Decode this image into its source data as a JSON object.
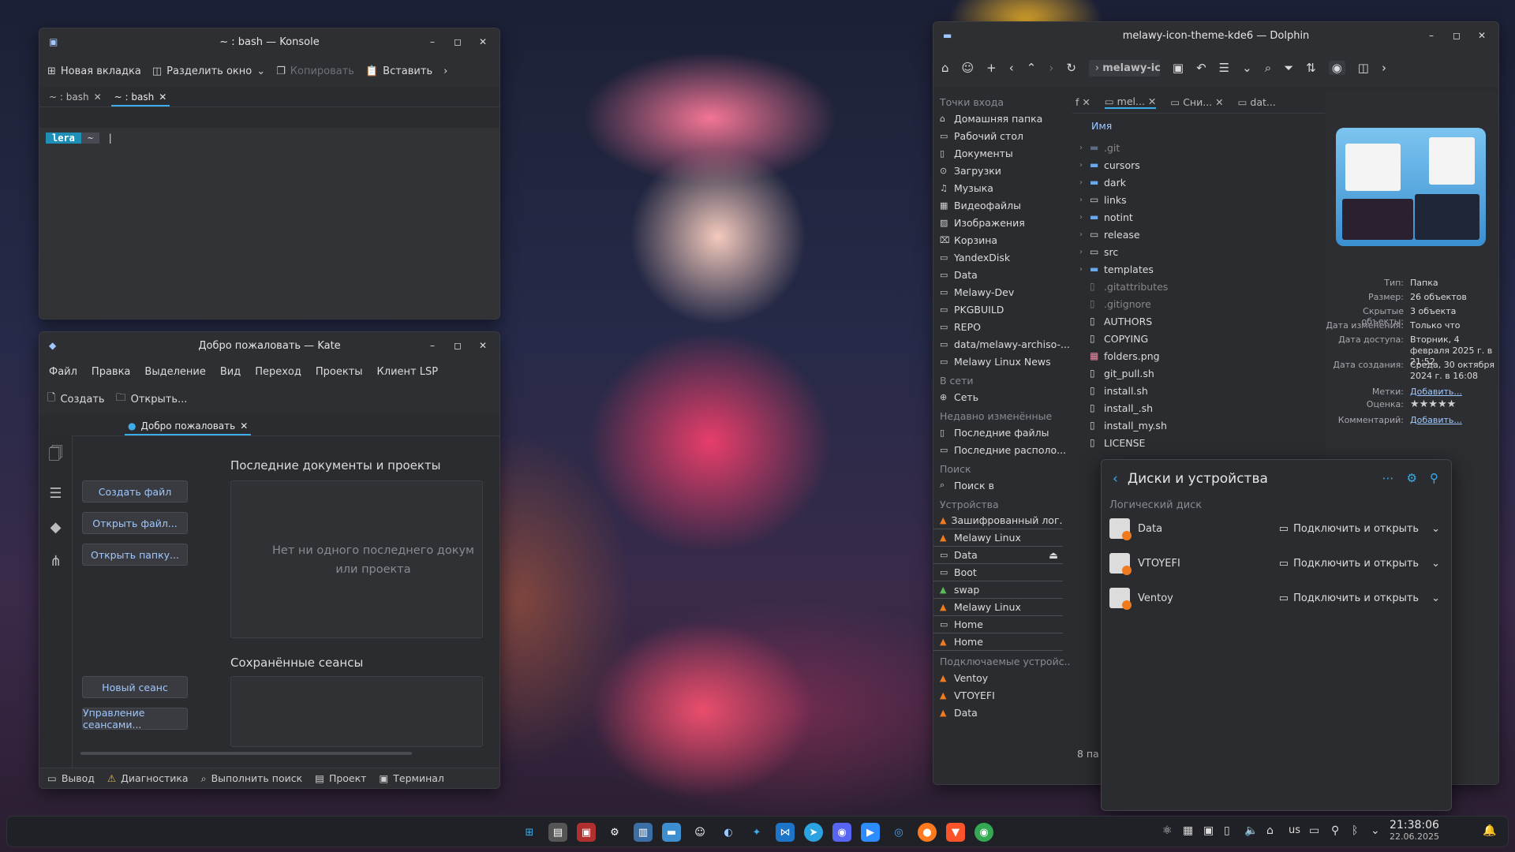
{
  "konsole": {
    "title": "~ : bash — Konsole",
    "toolbar": {
      "new_tab": "Новая вкладка",
      "split": "Разделить окно",
      "copy": "Копировать",
      "paste": "Вставить"
    },
    "tabs": [
      "~ : bash",
      "~ : bash"
    ],
    "prompt_user": "lera",
    "prompt_dir": "~"
  },
  "kate": {
    "title": "Добро пожаловать — Kate",
    "menu": [
      "Файл",
      "Правка",
      "Выделение",
      "Вид",
      "Переход",
      "Проекты",
      "Клиент LSP"
    ],
    "toolbar": {
      "create": "Создать",
      "open": "Открыть..."
    },
    "tab": "Добро пожаловать",
    "buttons": {
      "create_file": "Создать файл",
      "open_file": "Открыть файл...",
      "open_folder": "Открыть папку...",
      "new_session": "Новый сеанс",
      "manage_sessions": "Управление сеансами..."
    },
    "recent_title": "Последние документы и проекты",
    "recent_empty": "Нет ни одного последнего докум или проекта",
    "sessions_title": "Сохранённые сеансы",
    "status": [
      "Вывод",
      "Диагностика",
      "Выполнить поиск",
      "Проект",
      "Терминал"
    ]
  },
  "dolphin": {
    "title": "melawy-icon-theme-kde6 — Dolphin",
    "location": "melawy-icc",
    "tabs": [
      "f",
      "mel...",
      "Сни...",
      "dat..."
    ],
    "column_header": "Имя",
    "status_partial": "8 па",
    "places_groups": {
      "entry": "Точки входа",
      "network": "В сети",
      "recent": "Недавно изменённые",
      "search": "Поиск",
      "devices": "Устройства",
      "removable": "Подключаемые устройс..."
    },
    "places_entry": [
      "Домашняя папка",
      "Рабочий стол",
      "Документы",
      "Загрузки",
      "Музыка",
      "Видеофайлы",
      "Изображения",
      "Корзина",
      "YandexDisk",
      "Data",
      "Melawy-Dev",
      "PKGBUILD",
      "REPO",
      "data/melawy-archiso-...",
      "Melawy Linux News"
    ],
    "places_network": [
      "Сеть"
    ],
    "places_recent": [
      "Последние файлы",
      "Последние располо..."
    ],
    "places_search": [
      "Поиск в"
    ],
    "places_devices": [
      "Зашифрованный лог...",
      "Melawy Linux",
      "Data",
      "Boot",
      "swap",
      "Melawy Linux",
      "Home",
      "Home"
    ],
    "places_removable": [
      "Ventoy",
      "VTOYEFI",
      "Data"
    ],
    "files": [
      ".git",
      "cursors",
      "dark",
      "links",
      "notint",
      "release",
      "src",
      "templates",
      ".gitattributes",
      ".gitignore",
      "AUTHORS",
      "COPYING",
      "folders.png",
      "git_pull.sh",
      "install.sh",
      "install_.sh",
      "install_my.sh",
      "LICENSE"
    ],
    "info": [
      {
        "k": "Тип:",
        "v": "Папка"
      },
      {
        "k": "Размер:",
        "v": "26 объектов"
      },
      {
        "k": "Скрытые объекты:",
        "v": "3 объекта"
      },
      {
        "k": "Дата изменения:",
        "v": "Только что"
      },
      {
        "k": "Дата доступа:",
        "v": "Вторник, 4 февраля 2025 г. в 21:52"
      },
      {
        "k": "Дата создания:",
        "v": "Среда, 30 октября 2024 г. в 16:08"
      },
      {
        "k": "Метки:",
        "v": "Добавить..."
      },
      {
        "k": "Оценка:",
        "v": "★★★★★"
      },
      {
        "k": "Комментарий:",
        "v": "Добавить..."
      }
    ]
  },
  "disks": {
    "title": "Диски и устройства",
    "group": "Логический диск",
    "devices": [
      {
        "name": "Data",
        "action": "Подключить и открыть"
      },
      {
        "name": "VTOYEFI",
        "action": "Подключить и открыть"
      },
      {
        "name": "Ventoy",
        "action": "Подключить и открыть"
      }
    ]
  },
  "taskbar": {
    "layout": "us",
    "time": "21:38:06",
    "date": "22.06.2025"
  },
  "colors": {
    "accent": "#3daee9",
    "window": "#2b2c30",
    "link": "#9ec8ff"
  }
}
